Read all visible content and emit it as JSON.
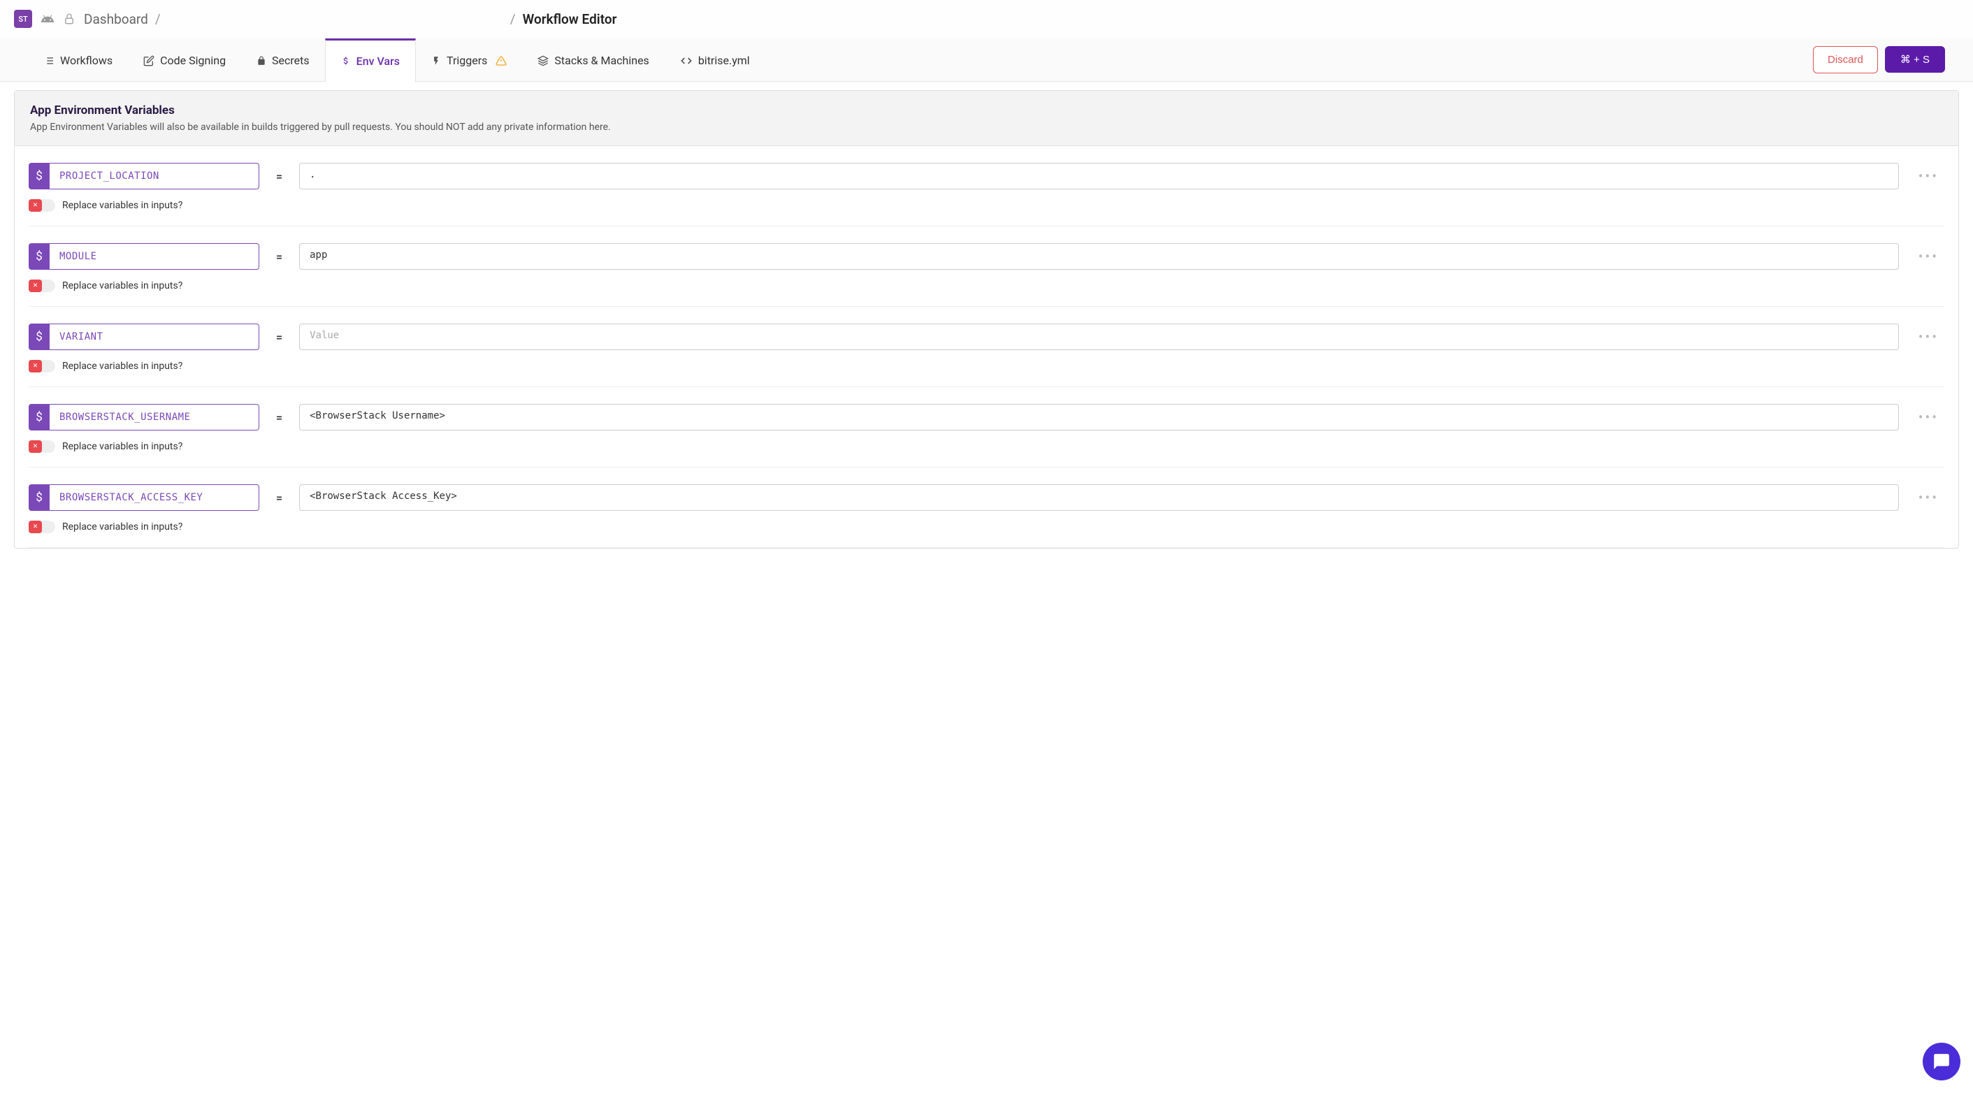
{
  "header": {
    "avatar_initials": "ST",
    "breadcrumb_dashboard": "Dashboard",
    "breadcrumb_empty": "",
    "breadcrumb_current": "Workflow Editor"
  },
  "tabs": {
    "workflows": "Workflows",
    "code_signing": "Code Signing",
    "secrets": "Secrets",
    "env_vars": "Env Vars",
    "triggers": "Triggers",
    "stacks": "Stacks & Machines",
    "bitrise_yml": "bitrise.yml"
  },
  "actions": {
    "discard": "Discard",
    "save": "⌘ + S"
  },
  "panel": {
    "title": "App Environment Variables",
    "subtitle": "App Environment Variables will also be available in builds triggered by pull requests. You should NOT add any private information here."
  },
  "vars": [
    {
      "key": "PROJECT_LOCATION",
      "value": ".",
      "placeholder": "Value",
      "toggle_label": "Replace variables in inputs?"
    },
    {
      "key": "MODULE",
      "value": "app",
      "placeholder": "Value",
      "toggle_label": "Replace variables in inputs?"
    },
    {
      "key": "VARIANT",
      "value": "",
      "placeholder": "Value",
      "toggle_label": "Replace variables in inputs?"
    },
    {
      "key": "BROWSERSTACK_USERNAME",
      "value": "<BrowserStack Username>",
      "placeholder": "Value",
      "toggle_label": "Replace variables in inputs?"
    },
    {
      "key": "BROWSERSTACK_ACCESS_KEY",
      "value": "<BrowserStack Access_Key>",
      "placeholder": "Value",
      "toggle_label": "Replace variables in inputs?"
    }
  ],
  "equals_sign": "="
}
